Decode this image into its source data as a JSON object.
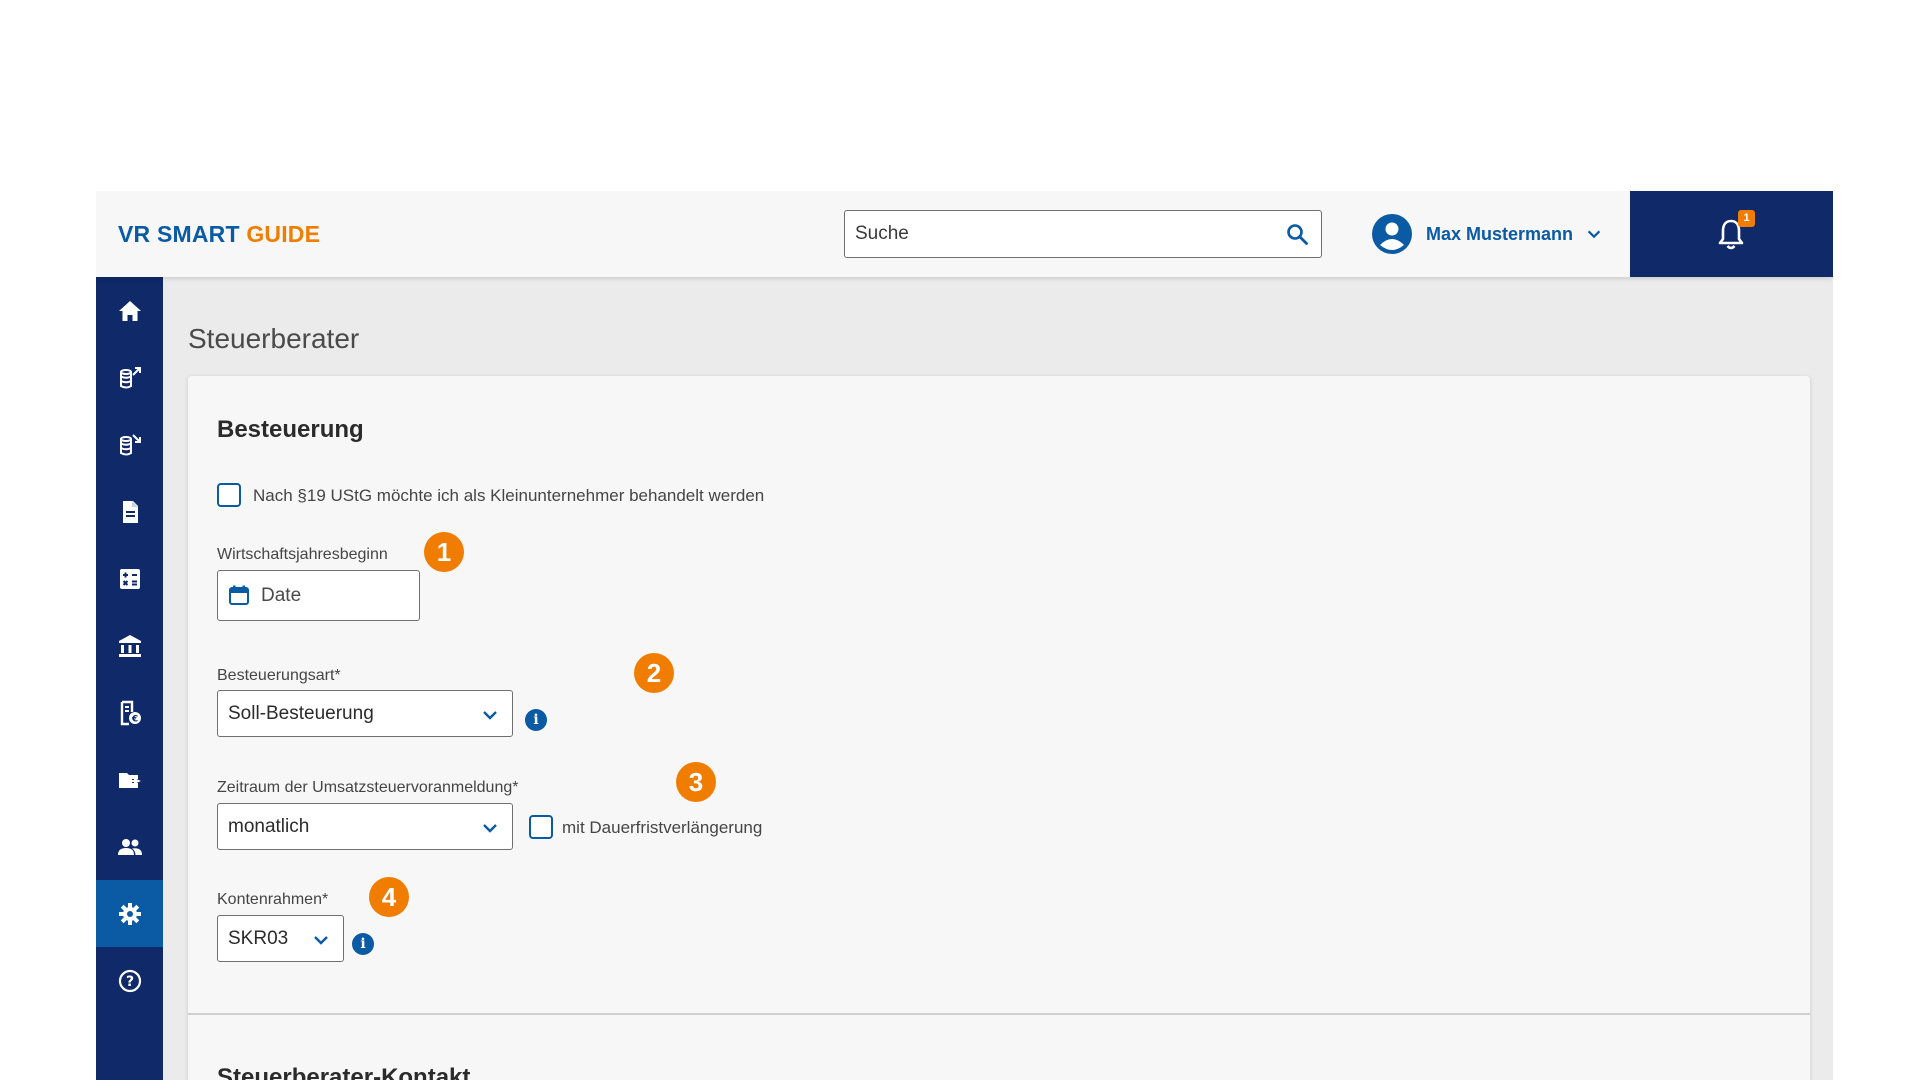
{
  "header": {
    "logo_vr": "VR SMART ",
    "logo_guide": "GUIDE",
    "search_placeholder": "Suche",
    "user_name": "Max Mustermann",
    "notification_count": "1"
  },
  "page": {
    "title": "Steuerberater"
  },
  "besteuerung": {
    "section_title": "Besteuerung",
    "kleinunternehmer_label": "Nach §19 UStG möchte ich als Kleinunternehmer behandelt werden",
    "kleinunternehmer_checked": false,
    "wirtschaftsjahr_label": "Wirtschaftsjahresbeginn",
    "wirtschaftsjahr_value": "Date",
    "besteuerungsart_label": "Besteuerungsart*",
    "besteuerungsart_value": "Soll-Besteuerung",
    "zeitraum_label": "Zeitraum der Umsatzsteuervoranmeldung*",
    "zeitraum_value": "monatlich",
    "dauerfrist_label": "mit Dauerfristverlängerung",
    "dauerfrist_checked": false,
    "kontenrahmen_label": "Kontenrahmen*",
    "kontenrahmen_value": "SKR03",
    "markers": [
      "1",
      "2",
      "3",
      "4"
    ],
    "info_glyph": "i"
  },
  "kontakt": {
    "section_title": "Steuerberater-Kontakt"
  },
  "colors": {
    "navy": "#0f2969",
    "blue": "#0a5aa4",
    "orange": "#f07d00",
    "background": "#ebebeb",
    "card": "#f7f7f7"
  },
  "sidebar": {
    "items": [
      {
        "icon": "home-icon"
      },
      {
        "icon": "coins-out-icon"
      },
      {
        "icon": "coins-in-icon"
      },
      {
        "icon": "document-icon"
      },
      {
        "icon": "calculator-icon"
      },
      {
        "icon": "bank-icon"
      },
      {
        "icon": "receipt-euro-icon"
      },
      {
        "icon": "folder-export-icon"
      },
      {
        "icon": "people-icon"
      },
      {
        "icon": "gear-icon",
        "active": true
      },
      {
        "icon": "help-icon"
      }
    ]
  }
}
